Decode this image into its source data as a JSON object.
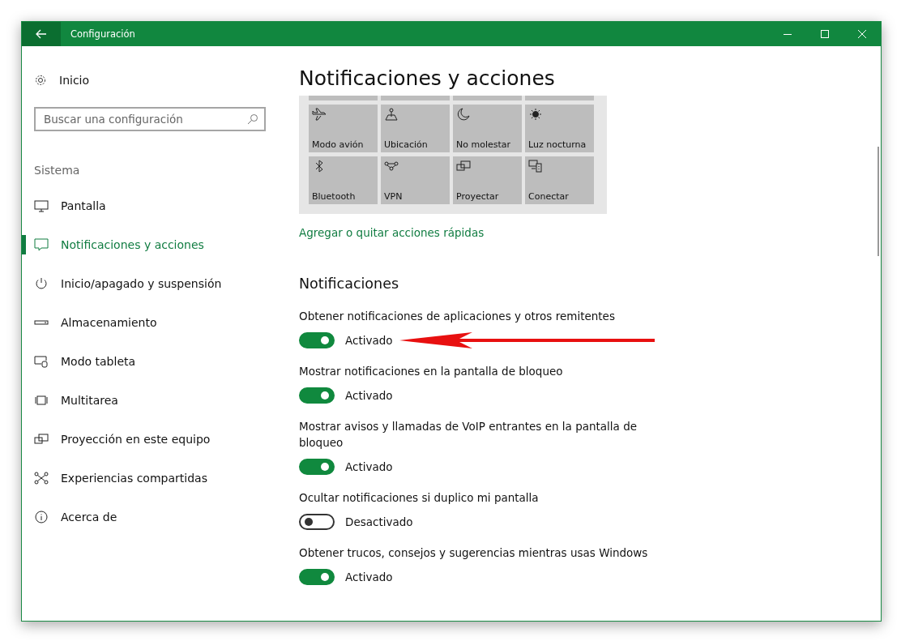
{
  "window": {
    "title": "Configuración"
  },
  "sidebar": {
    "home": "Inicio",
    "search": {
      "placeholder": "Buscar una configuración"
    },
    "section": "Sistema",
    "items": [
      {
        "label": "Pantalla",
        "selected": false
      },
      {
        "label": "Notificaciones y acciones",
        "selected": true
      },
      {
        "label": "Inicio/apagado y suspensión",
        "selected": false
      },
      {
        "label": "Almacenamiento",
        "selected": false
      },
      {
        "label": "Modo tableta",
        "selected": false
      },
      {
        "label": "Multitarea",
        "selected": false
      },
      {
        "label": "Proyección en este equipo",
        "selected": false
      },
      {
        "label": "Experiencias compartidas",
        "selected": false
      },
      {
        "label": "Acerca de",
        "selected": false
      }
    ]
  },
  "page": {
    "title": "Notificaciones y acciones",
    "quick_actions": [
      {
        "label": "Modo avión"
      },
      {
        "label": "Ubicación"
      },
      {
        "label": "No molestar"
      },
      {
        "label": "Luz nocturna"
      },
      {
        "label": "Bluetooth"
      },
      {
        "label": "VPN"
      },
      {
        "label": "Proyectar"
      },
      {
        "label": "Conectar"
      }
    ],
    "quick_actions_link": "Agregar o quitar acciones rápidas",
    "section": "Notificaciones",
    "settings": [
      {
        "label": "Obtener notificaciones de aplicaciones y otros remitentes",
        "on": true,
        "status": "Activado"
      },
      {
        "label": "Mostrar notificaciones en la pantalla de bloqueo",
        "on": true,
        "status": "Activado"
      },
      {
        "label": "Mostrar avisos y llamadas de VoIP entrantes en la pantalla de bloqueo",
        "on": true,
        "status": "Activado"
      },
      {
        "label": "Ocultar notificaciones si duplico mi pantalla",
        "on": false,
        "status": "Desactivado"
      },
      {
        "label": "Obtener trucos, consejos y sugerencias mientras usas Windows",
        "on": true,
        "status": "Activado"
      }
    ]
  }
}
